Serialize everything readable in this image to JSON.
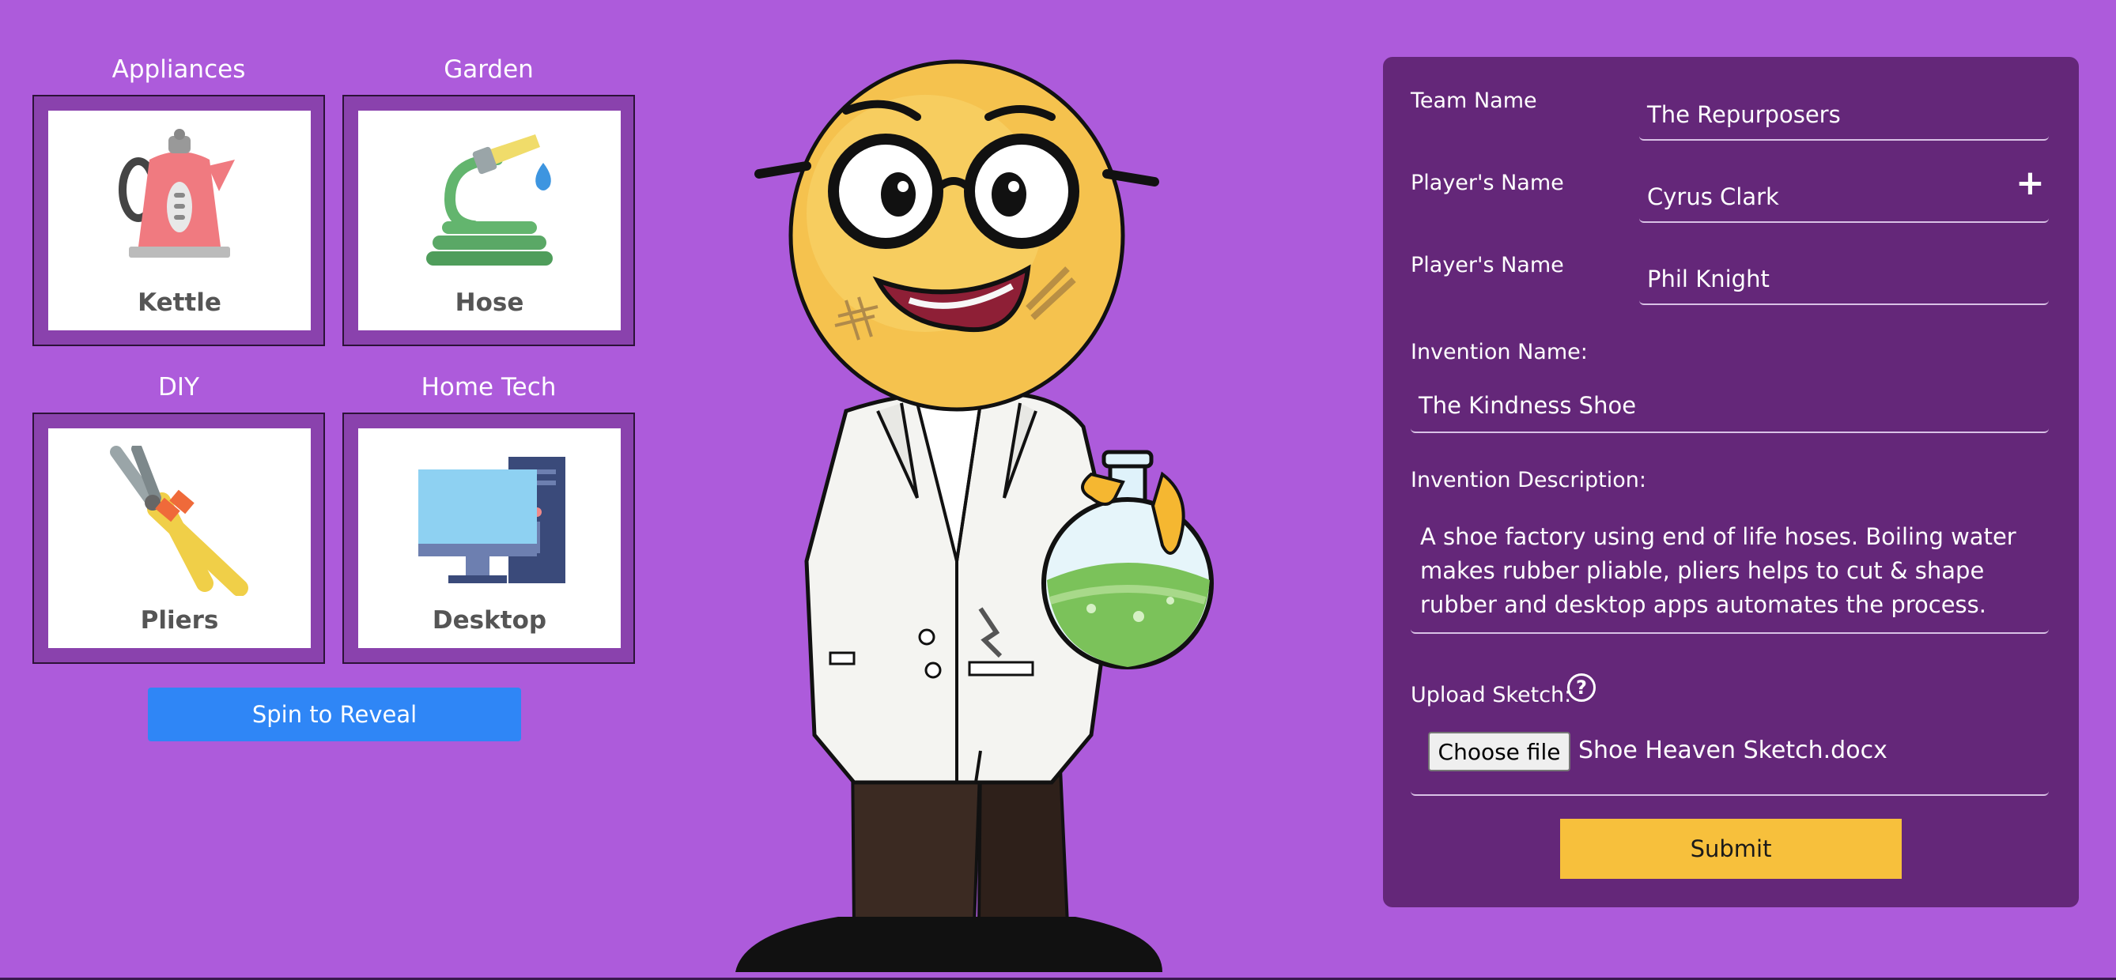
{
  "categories": [
    {
      "title": "Appliances",
      "item": "Kettle",
      "icon": "kettle-icon"
    },
    {
      "title": "Garden",
      "item": "Hose",
      "icon": "hose-icon"
    },
    {
      "title": "DIY",
      "item": "Pliers",
      "icon": "pliers-icon"
    },
    {
      "title": "Home Tech",
      "item": "Desktop",
      "icon": "desktop-icon"
    }
  ],
  "spin_button": "Spin to Reveal",
  "form": {
    "team_name_label": "Team Name",
    "team_name_value": "The Repurposers",
    "player_label": "Player's Name",
    "players": [
      "Cyrus Clark",
      "Phil Knight"
    ],
    "add_player_symbol": "+",
    "invention_name_label": "Invention Name:",
    "invention_name_value": "The Kindness Shoe",
    "invention_desc_label": "Invention Description:",
    "invention_desc_value": "A shoe factory using end of life hoses. Boiling water makes rubber pliable, pliers helps to cut & shape rubber and desktop apps automates the process.",
    "upload_label": "Upload Sketch:",
    "help_symbol": "?",
    "choose_file_label": "Choose file",
    "file_name": "Shoe Heaven Sketch.docx",
    "submit_label": "Submit"
  },
  "colors": {
    "background": "#ad5bdb",
    "panel": "#642779",
    "spin_button": "#2f86f6",
    "submit_button": "#f7c03c"
  }
}
